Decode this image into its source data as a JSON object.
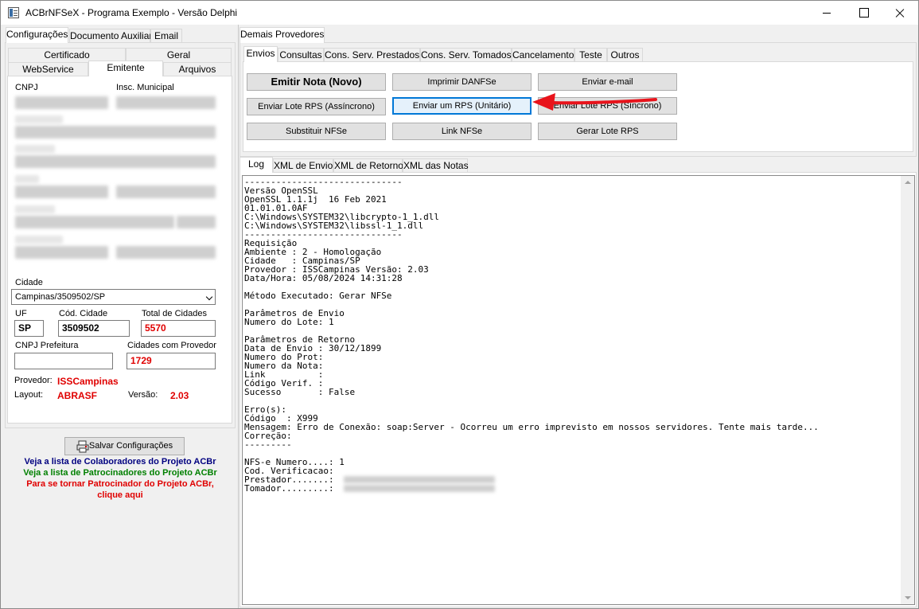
{
  "window": {
    "title": "ACBrNFSeX - Programa Exemplo - Versão Delphi"
  },
  "left": {
    "tabs": [
      "Configurações",
      "Documento Auxiliar",
      "Email"
    ],
    "subtabs_row1": [
      "Certificado",
      "Geral"
    ],
    "subtabs_row2": [
      "WebService",
      "Emitente",
      "Arquivos"
    ],
    "labels": {
      "cnpj": "CNPJ",
      "insc": "Insc. Municipal"
    },
    "cidade": {
      "label": "Cidade",
      "value": "Campinas/3509502/SP"
    },
    "uf": {
      "label": "UF",
      "value": "SP"
    },
    "cod_cidade": {
      "label": "Cód. Cidade",
      "value": "3509502"
    },
    "total_cidades": {
      "label": "Total de Cidades",
      "value": "5570"
    },
    "cnpj_prefeitura": {
      "label": "CNPJ Prefeitura",
      "value": ""
    },
    "cidades_provedor": {
      "label": "Cidades com Provedor",
      "value": "1729"
    },
    "provedor": {
      "label": "Provedor:",
      "value": "ISSCampinas"
    },
    "layout": {
      "label": "Layout:",
      "value": "ABRASF"
    },
    "versao": {
      "label": "Versão:",
      "value": "2.03"
    },
    "save_button": "Salvar Configurações",
    "links": {
      "colaboradores": "Veja a lista de Colaboradores do Projeto ACBr",
      "patrocinadores": "Veja a lista de Patrocinadores do Projeto ACBr",
      "patrocinador_line1": "Para se tornar Patrocinador do Projeto ACBr,",
      "patrocinador_line2": "clique aqui"
    }
  },
  "right": {
    "top_tab": "Demais Provedores",
    "tabs": [
      "Envios",
      "Consultas",
      "Cons. Serv. Prestados",
      "Cons. Serv. Tomados",
      "Cancelamento",
      "Teste",
      "Outros"
    ],
    "buttons": {
      "emitir": "Emitir Nota (Novo)",
      "imprimir": "Imprimir DANFSe",
      "email": "Enviar e-mail",
      "lote_async": "Enviar Lote RPS (Assíncrono)",
      "rps_unitario": "Enviar um RPS (Unitário)",
      "lote_sync": "Enviar Lote RPS (Síncrono)",
      "substituir": "Substituir NFSe",
      "link": "Link NFSe",
      "gerar_lote": "Gerar Lote RPS"
    },
    "log_tabs": [
      "Log",
      "XML de Envio",
      "XML de Retorno",
      "XML das Notas"
    ],
    "log_lines": [
      "------------------------------",
      "Versão OpenSSL",
      "OpenSSL 1.1.1j  16 Feb 2021",
      "01.01.01.0AF",
      "C:\\Windows\\SYSTEM32\\libcrypto-1_1.dll",
      "C:\\Windows\\SYSTEM32\\libssl-1_1.dll",
      "------------------------------",
      "Requisição",
      "Ambiente : 2 - Homologação",
      "Cidade   : Campinas/SP",
      "Provedor : ISSCampinas Versão: 2.03",
      "Data/Hora: 05/08/2024 14:31:28",
      "",
      "Método Executado: Gerar NFSe",
      "",
      "Parâmetros de Envio",
      "Numero do Lote: 1",
      "",
      "Parâmetros de Retorno",
      "Data de Envio : 30/12/1899",
      "Numero do Prot:",
      "Numero da Nota:",
      "Link          :",
      "Código Verif. :",
      "Sucesso       : False",
      "",
      "Erro(s):",
      "Código  : X999",
      "Mensagem: Erro de Conexão: soap:Server - Ocorreu um erro imprevisto em nossos servidores. Tente mais tarde...",
      "Correção:",
      "---------",
      "",
      "NFS-e Numero....: 1",
      "Cod. Verificacao:",
      "Prestador.......:",
      "Tomador.........:"
    ]
  },
  "colors": {
    "accent": "#0078d7",
    "arrow": "#e8131b",
    "red_text": "#e00000",
    "link_blue": "#000080",
    "link_green": "#008000"
  }
}
